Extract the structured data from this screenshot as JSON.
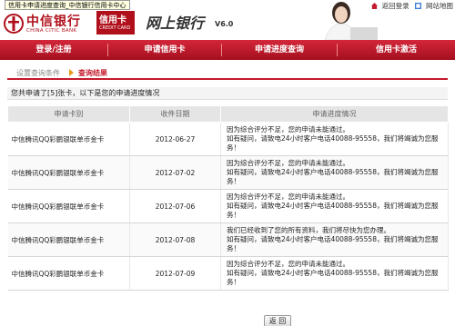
{
  "tooltip": "信用卡申请进度查询_中信银行信用卡中心",
  "header": {
    "bank_name_cn": "中信银行",
    "bank_name_en": "CHINA CITIC BANK",
    "card_cn": "信用卡",
    "card_en": "CREDIT CARD",
    "netbank": "网上银行",
    "version": "V6.0",
    "links": {
      "home": "返回登录",
      "site_map": "网站地图"
    }
  },
  "nav": {
    "items": [
      "登录/注册",
      "申请信用卡",
      "申请进度查询",
      "信用卡激活"
    ]
  },
  "tabs": {
    "set_query": "设置查询条件",
    "query_result": "查询结果"
  },
  "summary": "您共申请了[5]张卡，以下是您的申请进度情况",
  "table": {
    "headers": [
      "申请卡别",
      "收件日期",
      "申请进度情况"
    ],
    "rows": [
      {
        "card": "中信腾讯QQ彩鹏银联单币金卡",
        "date": "2012-06-27",
        "line1": "因为综合评分不足，您的申请未能通过。",
        "line2": "如有疑问，请致电24小时客户电话40088-95558，我们将竭诚为您服务！"
      },
      {
        "card": "中信腾讯QQ彩鹏银联单币金卡",
        "date": "2012-07-02",
        "line1": "因为综合评分不足，您的申请未能通过。",
        "line2": "如有疑问，请致电24小时客户电话40088-95558，我们将竭诚为您服务！"
      },
      {
        "card": "中信腾讯QQ彩鹏银联单币金卡",
        "date": "2012-07-06",
        "line1": "因为综合评分不足，您的申请未能通过。",
        "line2": "如有疑问，请致电24小时客户电话40088-95558，我们将竭诚为您服务！"
      },
      {
        "card": "中信腾讯QQ彩鹏银联单币金卡",
        "date": "2012-07-08",
        "line1": "我们已经收到了您的所有资料，我们将尽快为您办理。",
        "line2": "如有疑问，请致电24小时客户电话40088-95558，我们将竭诚为您服务！"
      },
      {
        "card": "中信腾讯QQ彩鹏银联单币金卡",
        "date": "2012-07-09",
        "line1": "因为综合评分不足，您的申请未能通过。",
        "line2": "如有疑问，请致电24小时客户电话40088-95558，我们将竭诚为您服务！"
      }
    ]
  },
  "back_button": "返 回"
}
